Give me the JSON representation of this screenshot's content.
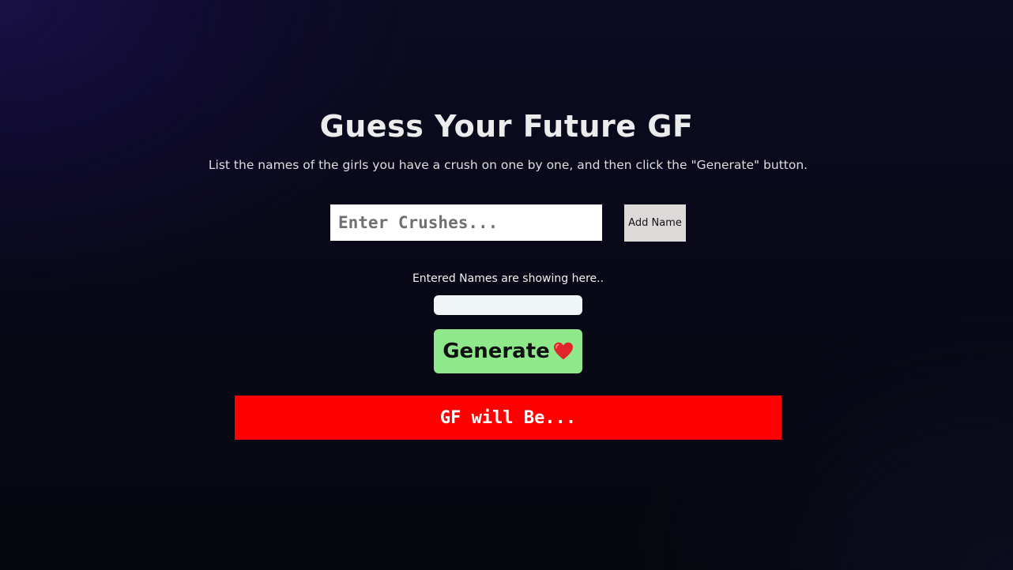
{
  "header": {
    "title": "Guess Your Future GF",
    "subtitle": "List the names of the girls you have a crush on one by one, and then click the \"Generate\" button."
  },
  "form": {
    "input_value": "",
    "input_placeholder": "Enter Crushes...",
    "add_button_label": "Add Name"
  },
  "names_list": {
    "label": "Entered Names are showing here..",
    "items": []
  },
  "generate": {
    "label": "Generate",
    "icon": "heart-icon"
  },
  "result": {
    "text": "GF will Be..."
  },
  "colors": {
    "generate_bg": "#8fe88a",
    "result_bg": "#ff0000",
    "add_button_bg": "#ddd9d9"
  }
}
